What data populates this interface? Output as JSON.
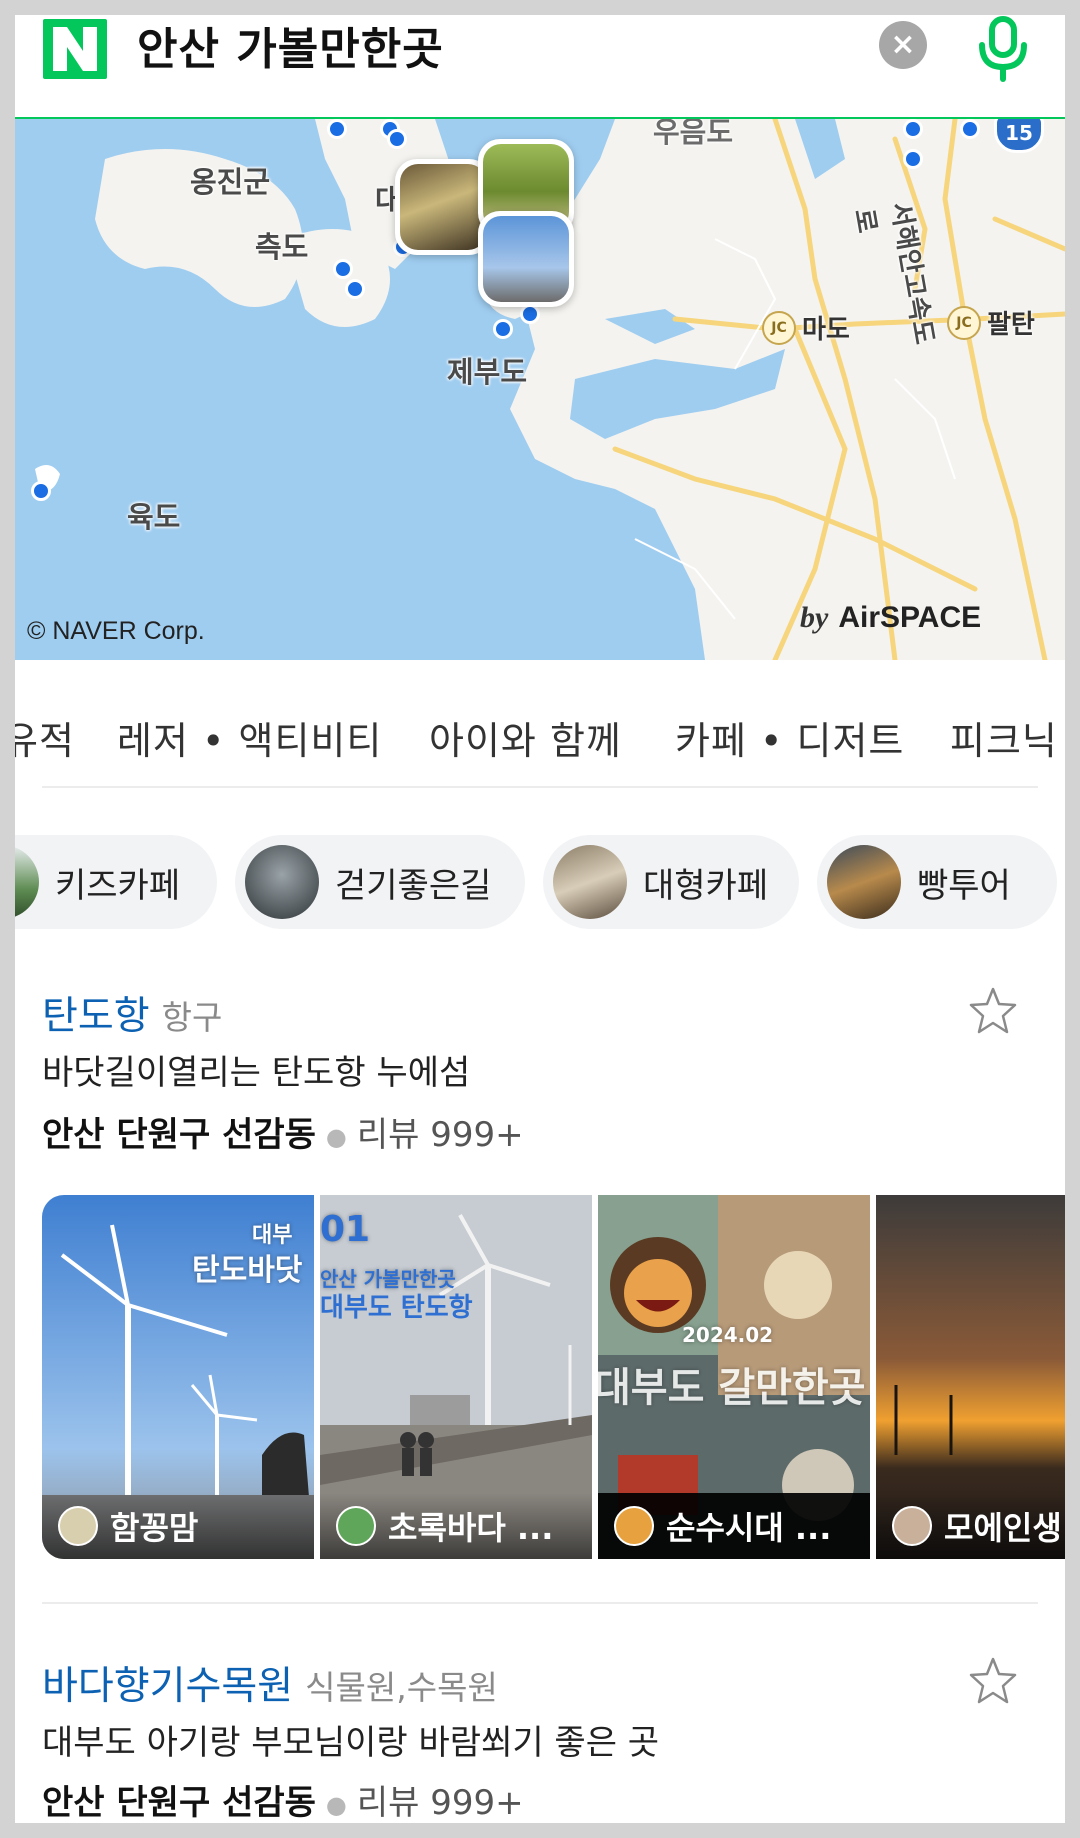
{
  "search": {
    "query": "안산 가볼만한곳",
    "clear_label": "×"
  },
  "map": {
    "labels": {
      "ongjin": "옹진군",
      "cheukdo": "측도",
      "jebudo": "제부도",
      "yukdo": "육도",
      "da": "대",
      "ueumdo": "우음도",
      "mado": "마도",
      "paltan": "팔탄",
      "highway": "서해안고속도로"
    },
    "jc_badge": "JC",
    "road_number": "15",
    "copyright": "© NAVER Corp.",
    "airspace_by": "by",
    "airspace": "AirSPACE",
    "colors": {
      "sea": "#9fcdf0",
      "land": "#f4f3ef",
      "road": "#f6d57c",
      "pin": "#1a6de3"
    }
  },
  "category_tabs": [
    "유적",
    "레저 • 액티비티",
    "아이와 함께",
    "카페 • 디저트",
    "피크닉"
  ],
  "chips": [
    "키즈카페",
    "걷기좋은길",
    "대형카페",
    "빵투어"
  ],
  "places": [
    {
      "name": "탄도항",
      "category": "항구",
      "description": "바닷길이열리는 탄도항 누에섬",
      "address": "안산 단원구 선감동",
      "reviews": "리뷰 999+",
      "photos": [
        {
          "author": "함꽁맘",
          "overlay": "탄도바닷",
          "overlay_small": "대부"
        },
        {
          "author": "초록바다 ...",
          "overlay": "대부도 탄도항",
          "overlay_small": "안산 가볼만한곳"
        },
        {
          "author": "순수시대 ...",
          "overlay": "대부도 갈만한곳",
          "overlay_small": "2024.02"
        },
        {
          "author": "모에인생"
        }
      ]
    },
    {
      "name": "바다향기수목원",
      "category": "식물원,수목원",
      "description": "대부도 아기랑 부모님이랑 바람쐬기 좋은 곳",
      "address": "안산 단원구 선감동",
      "reviews": "리뷰 999+"
    }
  ],
  "brand_color": "#03c75a",
  "link_color": "#0c61b3"
}
